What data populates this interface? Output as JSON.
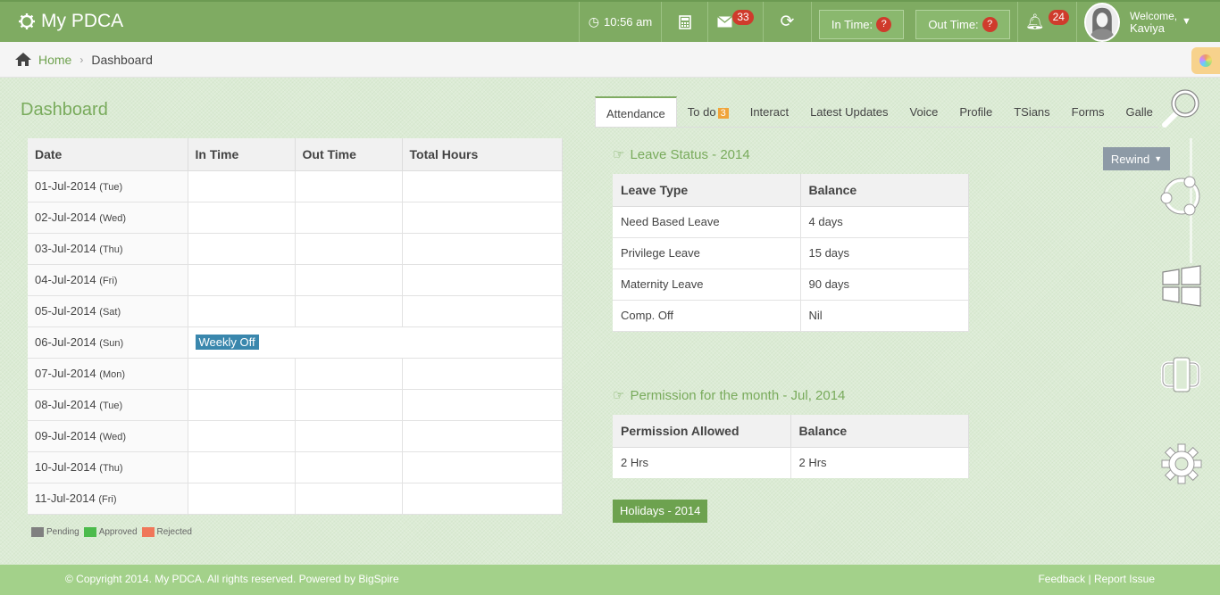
{
  "header": {
    "app_title": "My PDCA",
    "time": "10:56 am",
    "mail_count": "33",
    "in_time_label": "In Time:",
    "in_time_badge": "?",
    "out_time_label": "Out Time:",
    "out_time_badge": "?",
    "notification_count": "24",
    "welcome_label": "Welcome,",
    "user_name": "Kaviya"
  },
  "breadcrumb": {
    "home": "Home",
    "current": "Dashboard"
  },
  "page_title": "Dashboard",
  "attendance": {
    "columns": [
      "Date",
      "In Time",
      "Out Time",
      "Total Hours"
    ],
    "rows": [
      {
        "date": "01-Jul-2014",
        "day": "(Tue)"
      },
      {
        "date": "02-Jul-2014",
        "day": "(Wed)"
      },
      {
        "date": "03-Jul-2014",
        "day": "(Thu)"
      },
      {
        "date": "04-Jul-2014",
        "day": "(Fri)"
      },
      {
        "date": "05-Jul-2014",
        "day": "(Sat)"
      },
      {
        "date": "06-Jul-2014",
        "day": "(Sun)",
        "note": "Weekly Off"
      },
      {
        "date": "07-Jul-2014",
        "day": "(Mon)"
      },
      {
        "date": "08-Jul-2014",
        "day": "(Tue)"
      },
      {
        "date": "09-Jul-2014",
        "day": "(Wed)"
      },
      {
        "date": "10-Jul-2014",
        "day": "(Thu)"
      },
      {
        "date": "11-Jul-2014",
        "day": "(Fri)"
      }
    ]
  },
  "legend": {
    "items": [
      {
        "label": "Pending",
        "color": "#808080"
      },
      {
        "label": "Approved",
        "color": "#4cbb4c"
      },
      {
        "label": "Rejected",
        "color": "#f0775a"
      }
    ]
  },
  "tabs": [
    {
      "label": "Attendance",
      "active": true
    },
    {
      "label": "To do",
      "badge": "3"
    },
    {
      "label": "Interact"
    },
    {
      "label": "Latest Updates"
    },
    {
      "label": "Voice"
    },
    {
      "label": "Profile"
    },
    {
      "label": "TSians"
    },
    {
      "label": "Forms"
    },
    {
      "label": "Galle"
    }
  ],
  "rewind_label": "Rewind",
  "leave_status": {
    "title": "Leave Status - 2014",
    "columns": [
      "Leave Type",
      "Balance"
    ],
    "rows": [
      [
        "Need Based Leave",
        "4 days"
      ],
      [
        "Privilege Leave",
        "15 days"
      ],
      [
        "Maternity Leave",
        "90 days"
      ],
      [
        "Comp. Off",
        "Nil"
      ]
    ]
  },
  "permission": {
    "title": "Permission for the month - Jul, 2014",
    "columns": [
      "Permission Allowed",
      "Balance"
    ],
    "rows": [
      [
        "2 Hrs",
        "2 Hrs"
      ]
    ]
  },
  "holidays_label": "Holidays - 2014",
  "footer": {
    "copyright": "© Copyright 2014. My PDCA. All rights reserved. Powered by BigSpire",
    "feedback": "Feedback",
    "report_issue": "Report Issue"
  }
}
